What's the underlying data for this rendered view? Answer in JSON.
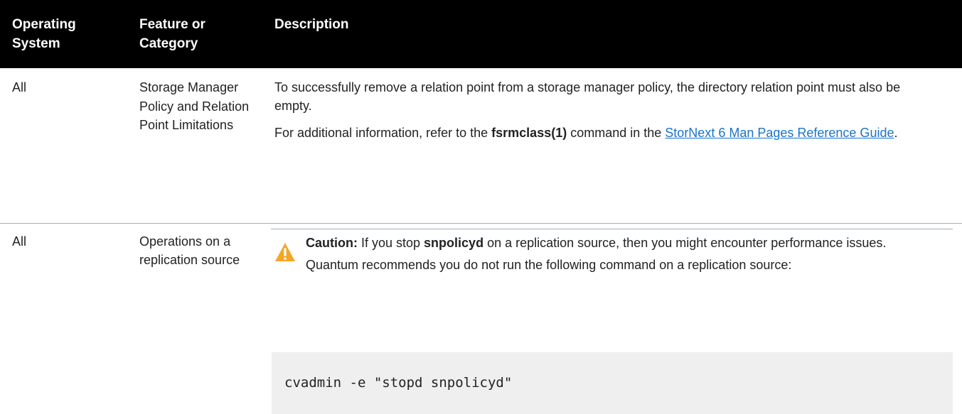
{
  "table": {
    "headers": {
      "os": "Operating System",
      "feature": "Feature or Category",
      "description": "Description"
    },
    "rows": [
      {
        "os": "All",
        "feature": "Storage Manager Policy and Relation Point Limitations",
        "desc_p1": "To successfully remove a relation point from a storage manager policy, the directory relation point must also be empty.",
        "desc_p2_prefix": "For additional information, refer to the ",
        "desc_p2_bold": "fsrmclass(1)",
        "desc_p2_middle": " command in the ",
        "desc_p2_link": "StorNext 6 Man Pages Reference Guide",
        "desc_p2_suffix": "."
      },
      {
        "os": "All",
        "feature": "Operations on a replication source",
        "caution_label": "Caution:",
        "caution_t1": " If you stop ",
        "caution_bold": "snpolicyd",
        "caution_t2": " on a replication source, then you might encounter performance issues. Quantum recommends you do not run the following command on a replication source:",
        "code": "cvadmin -e \"stopd snpolicyd\""
      }
    ]
  },
  "colors": {
    "header_bg": "#000000",
    "link": "#1a73c8",
    "warning": "#f5a623",
    "code_bg": "#efefef",
    "divider": "#9fb0ba"
  },
  "icons": {
    "caution": "warning-triangle-icon"
  }
}
